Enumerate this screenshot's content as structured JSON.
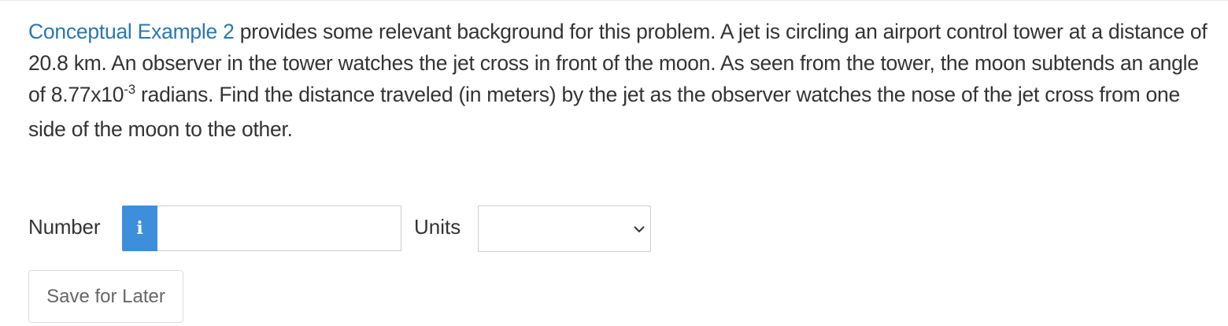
{
  "question": {
    "link_text": "Conceptual Example 2",
    "text_part1": " provides some relevant background for this problem. A jet is circling an airport control tower at a distance of 20.8 km. An observer in the tower watches the jet cross in front of the moon. As seen from the tower, the moon subtends an angle of 8.77x10",
    "exponent": "-3",
    "text_part2": " radians. Find the distance traveled (in meters) by the jet as the observer watches the nose of the jet cross from one side of the moon to the other."
  },
  "answer": {
    "number_label": "Number",
    "info_glyph": "i",
    "number_value": "",
    "units_label": "Units",
    "units_selected": ""
  },
  "actions": {
    "save_label": "Save for Later"
  },
  "colors": {
    "link": "#2a77b1",
    "info_button": "#3d8fdb"
  },
  "icons": {
    "info": "info-icon",
    "dropdown": "chevron-down-icon"
  }
}
